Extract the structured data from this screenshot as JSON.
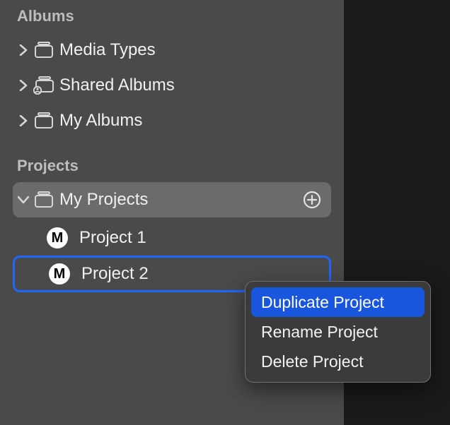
{
  "albums": {
    "header": "Albums",
    "items": [
      {
        "label": "Media Types"
      },
      {
        "label": "Shared Albums"
      },
      {
        "label": "My Albums"
      }
    ]
  },
  "projects": {
    "header": "Projects",
    "root": {
      "label": "My Projects"
    },
    "children": [
      {
        "badge": "M",
        "label": "Project 1"
      },
      {
        "badge": "M",
        "label": "Project 2"
      }
    ]
  },
  "context_menu": {
    "items": [
      {
        "label": "Duplicate Project",
        "highlighted": true
      },
      {
        "label": "Rename Project",
        "highlighted": false
      },
      {
        "label": "Delete Project",
        "highlighted": false
      }
    ]
  }
}
